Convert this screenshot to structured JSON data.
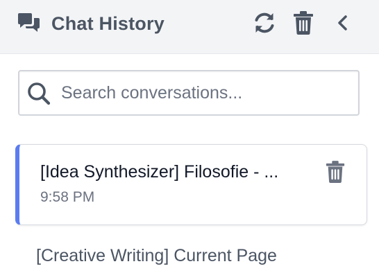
{
  "header": {
    "title": "Chat History",
    "icons": {
      "app": "chat-bubbles-icon",
      "refresh": "refresh-icon",
      "delete_all": "trash-icon",
      "collapse": "chevron-left-icon"
    }
  },
  "search": {
    "placeholder": "Search conversations...",
    "value": "",
    "icon": "search-icon"
  },
  "conversations": [
    {
      "title": "[Idea Synthesizer] Filosofie - ...",
      "time": "9:58 PM",
      "active": true,
      "delete_icon": "trash-icon"
    },
    {
      "title": "[Creative Writing] Current Page",
      "active": false
    }
  ],
  "colors": {
    "accent": "#5b7cf0",
    "header_bg": "#f3f4f6",
    "icon": "#4b5563",
    "muted_icon": "#6b7280"
  }
}
